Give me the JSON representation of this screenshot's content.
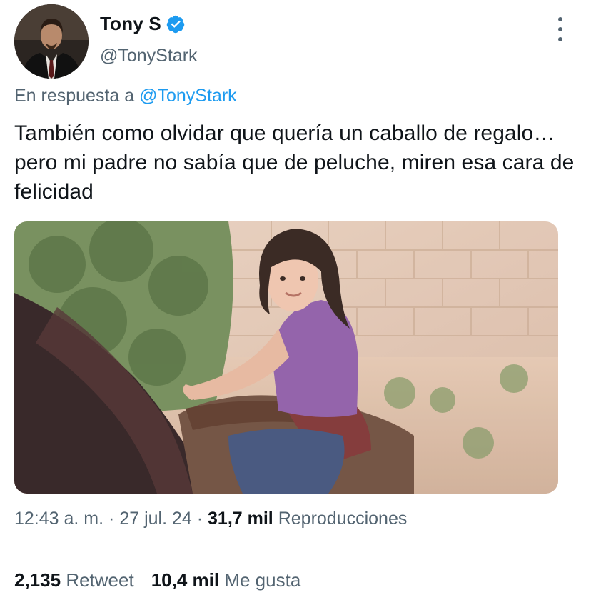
{
  "author": {
    "display_name": "Tony S",
    "handle": "@TonyStark",
    "verified_icon": "verified-badge-icon",
    "verified_color": "#1d9bf0"
  },
  "more_icon": "more-options-icon",
  "reply": {
    "prefix": "En respuesta a",
    "mention": "@TonyStark"
  },
  "tweet": {
    "text": "También como olvidar que quería un caballo de regalo… pero mi padre no sabía que de peluche, miren esa cara de felicidad"
  },
  "meta": {
    "time": "12:43 a. m.",
    "sep1": "·",
    "date": "27 jul. 24",
    "sep2": "·",
    "views_count": "31,7 mil",
    "views_label": "Reproducciones"
  },
  "stats": {
    "retweets_count": "2,135",
    "retweets_label": "Retweet",
    "likes_count": "10,4 mil",
    "likes_label": "Me gusta"
  },
  "colors": {
    "accent": "#1d9bf0",
    "secondary_text": "#536471",
    "primary_text": "#0f1419"
  }
}
